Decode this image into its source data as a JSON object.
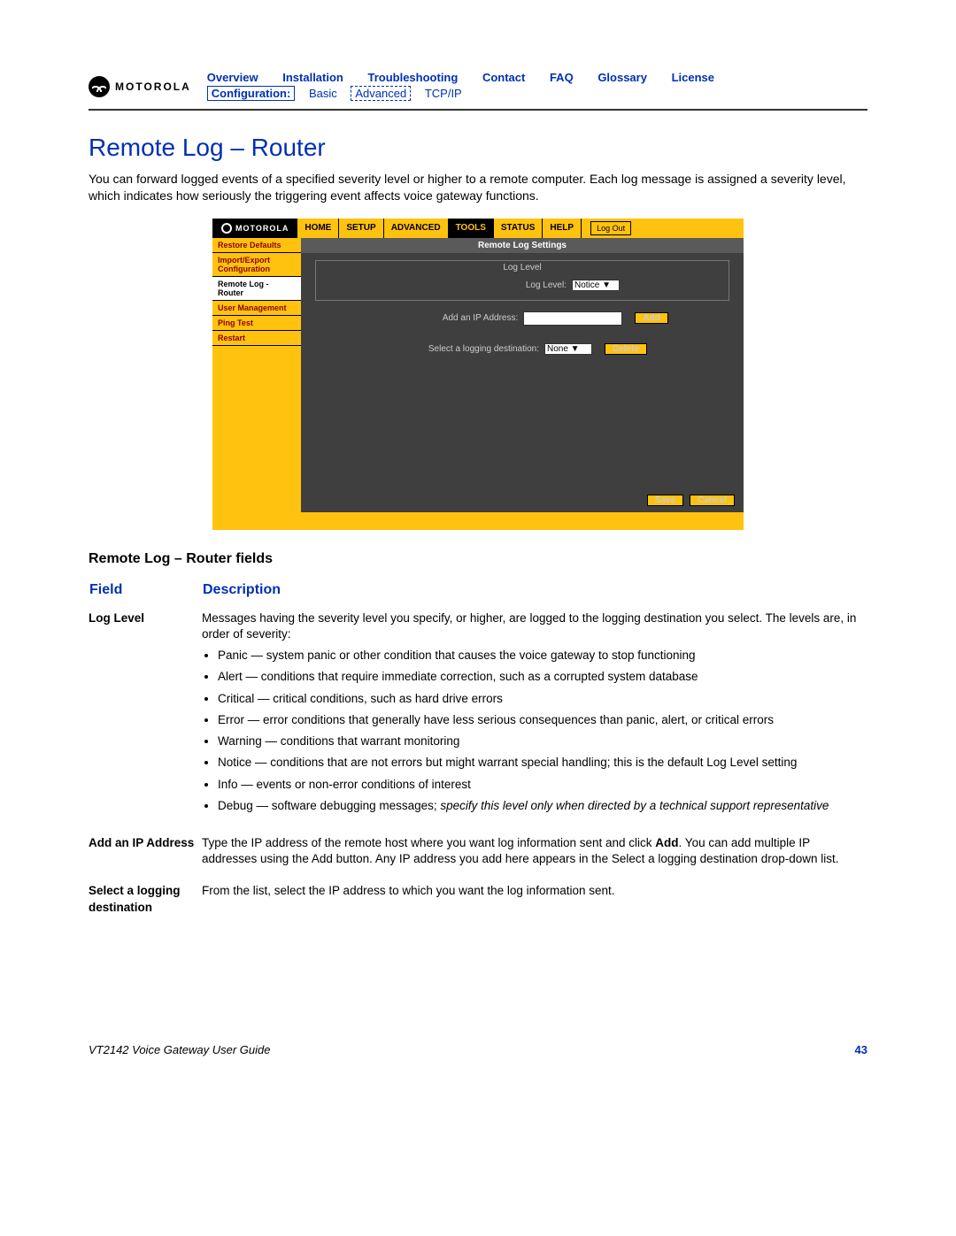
{
  "brand": "MOTOROLA",
  "nav_top": [
    "Overview",
    "Installation",
    "Troubleshooting",
    "Contact",
    "FAQ",
    "Glossary",
    "License"
  ],
  "nav_sub": {
    "cfg": "Configuration:",
    "basic": "Basic",
    "adv": "Advanced",
    "tcp": "TCP/IP"
  },
  "page_title": "Remote Log – Router",
  "intro": "You can forward logged events of a specified severity level or higher to a remote computer. Each log message is assigned a severity level, which indicates how seriously the triggering event affects voice gateway functions.",
  "shot": {
    "brand": "MOTOROLA",
    "tabs": [
      "HOME",
      "SETUP",
      "ADVANCED",
      "TOOLS",
      "STATUS",
      "HELP"
    ],
    "active_tab": "TOOLS",
    "logout": "Log Out",
    "side": [
      "Restore Defaults",
      "Import/Export Configuration",
      "Remote Log - Router",
      "User Management",
      "Ping Test",
      "Restart"
    ],
    "side_active": "Remote Log - Router",
    "header": "Remote Log Settings",
    "panel1": "Log Level",
    "loglevel_label": "Log Level:",
    "loglevel_value": "Notice",
    "ip_label": "Add an IP Address:",
    "add_btn": "Add",
    "dest_label": "Select a logging destination:",
    "dest_value": "None",
    "del_btn": "Delete",
    "save": "Save",
    "cancel": "Cancel"
  },
  "fields_title": "Remote Log – Router fields",
  "col_field": "Field",
  "col_desc": "Description",
  "row1_label": "Log Level",
  "row1_intro": "Messages having the severity level you specify, or higher, are logged to the logging destination you select. The levels are, in order of severity:",
  "bullets": [
    "Panic — system panic or other condition that causes the voice gateway to stop functioning",
    "Alert — conditions that require immediate correction, such as a corrupted system database",
    "Critical — critical conditions, such as hard drive errors",
    "Error — error conditions that generally have less serious consequences than panic, alert, or critical errors",
    "Warning — conditions that warrant monitoring",
    "Notice — conditions that are not errors but might warrant special handling; this is the default Log Level setting",
    "Info — events or non-error conditions of interest"
  ],
  "debug_prefix": "Debug — software debugging messages; ",
  "debug_italic": "specify this level only when directed by a technical support representative",
  "row2_label": "Add an IP Address",
  "row2_text_a": "Type the IP address of the remote host where you want log information sent and click ",
  "row2_bold": "Add",
  "row2_text_b": ". You can add multiple IP addresses using the Add button. Any IP address you add here appears in the Select a logging destination drop-down list.",
  "row3_label": "Select a logging destination",
  "row3_text": "From the list, select the IP address to which you want the log information sent.",
  "footer_title": "VT2142 Voice Gateway User Guide",
  "page_num": "43"
}
